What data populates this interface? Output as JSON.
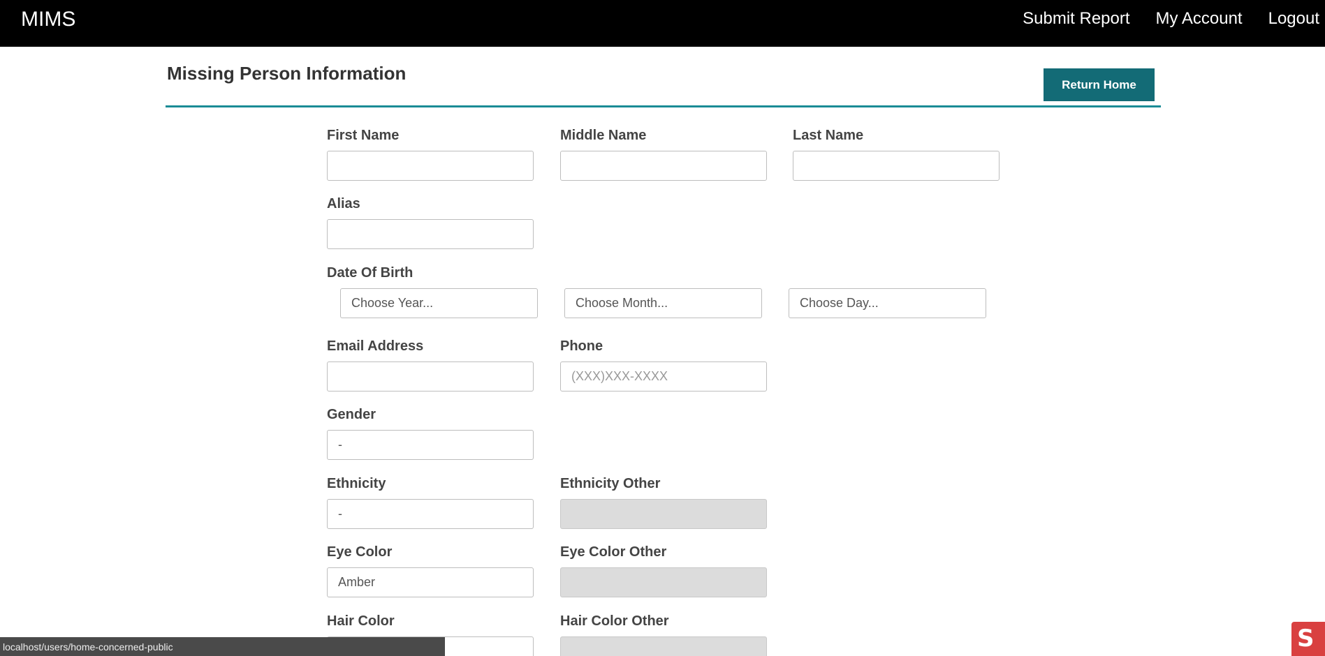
{
  "nav": {
    "brand": "MIMS",
    "links": [
      "Submit Report",
      "My Account",
      "Logout"
    ]
  },
  "header": {
    "title": "Missing Person Information",
    "return_button": "Return Home"
  },
  "form": {
    "first_name": {
      "label": "First Name",
      "value": ""
    },
    "middle_name": {
      "label": "Middle Name",
      "value": ""
    },
    "last_name": {
      "label": "Last Name",
      "value": ""
    },
    "alias": {
      "label": "Alias",
      "value": ""
    },
    "dob": {
      "label": "Date Of Birth",
      "year": "Choose Year...",
      "month": "Choose Month...",
      "day": "Choose Day..."
    },
    "email": {
      "label": "Email Address",
      "value": ""
    },
    "phone": {
      "label": "Phone",
      "placeholder": "(XXX)XXX-XXXX"
    },
    "gender": {
      "label": "Gender",
      "value": "-"
    },
    "ethnicity": {
      "label": "Ethnicity",
      "value": "-"
    },
    "ethnicity_other": {
      "label": "Ethnicity Other",
      "value": ""
    },
    "eye_color": {
      "label": "Eye Color",
      "value": "Amber"
    },
    "eye_color_other": {
      "label": "Eye Color Other",
      "value": ""
    },
    "hair_color": {
      "label": "Hair Color",
      "value": ""
    },
    "hair_color_other": {
      "label": "Hair Color Other",
      "value": ""
    }
  },
  "status_bar": {
    "url": "localhost/users/home-concerned-public"
  },
  "colors": {
    "navbar": "#000000",
    "accent": "#136b76",
    "divider": "#1a8b95",
    "disabled_field": "#dcdcdc"
  }
}
